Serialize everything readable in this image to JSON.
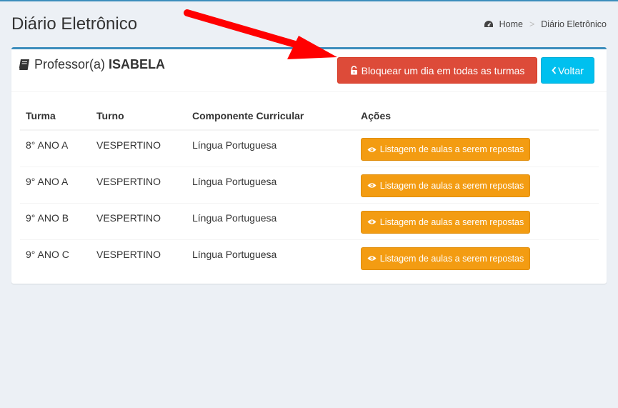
{
  "header": {
    "title": "Diário Eletrônico",
    "breadcrumb": {
      "home": "Home",
      "separator": ">",
      "current": "Diário Eletrônico"
    }
  },
  "box": {
    "prefix": "Professor(a)",
    "name": "ISABELA",
    "block_button": "Bloquear um dia em todas as turmas",
    "back_button": "Voltar"
  },
  "table": {
    "headers": [
      "Turma",
      "Turno",
      "Componente Curricular",
      "Ações"
    ],
    "rows": [
      {
        "turma": "8° ANO A",
        "turno": "VESPERTINO",
        "componente": "Língua Portuguesa",
        "acao": "Listagem de aulas a serem repostas"
      },
      {
        "turma": "9° ANO A",
        "turno": "VESPERTINO",
        "componente": "Língua Portuguesa",
        "acao": "Listagem de aulas a serem repostas"
      },
      {
        "turma": "9° ANO B",
        "turno": "VESPERTINO",
        "componente": "Língua Portuguesa",
        "acao": "Listagem de aulas a serem repostas"
      },
      {
        "turma": "9° ANO C",
        "turno": "VESPERTINO",
        "componente": "Língua Portuguesa",
        "acao": "Listagem de aulas a serem repostas"
      }
    ]
  },
  "colors": {
    "danger": "#dd4b39",
    "info": "#00c0ef",
    "warning": "#f39c12",
    "annotation_arrow": "#ff0000"
  },
  "icons": {
    "breadcrumb": "dashboard-icon",
    "title": "book-icon",
    "block": "unlock-icon",
    "back": "chevron-left-icon",
    "row_action": "eye-icon"
  }
}
